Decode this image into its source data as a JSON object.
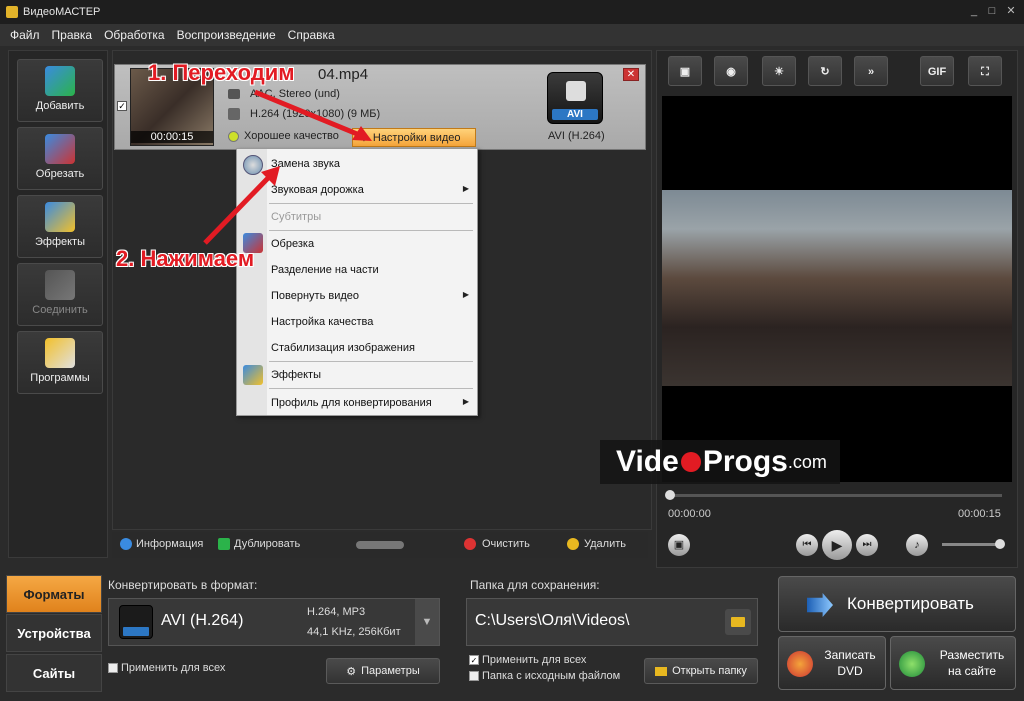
{
  "window": {
    "title": "ВидеоМАСТЕР"
  },
  "menu": [
    "Файл",
    "Правка",
    "Обработка",
    "Воспроизведение",
    "Справка"
  ],
  "tools": [
    {
      "label": "Добавить",
      "icon": "film-add-icon",
      "enabled": true
    },
    {
      "label": "Обрезать",
      "icon": "scissors-icon",
      "enabled": true
    },
    {
      "label": "Эффекты",
      "icon": "magic-wand-icon",
      "enabled": true
    },
    {
      "label": "Соединить",
      "icon": "film-join-icon",
      "enabled": false
    },
    {
      "label": "Программы",
      "icon": "programs-icon",
      "enabled": true
    }
  ],
  "file": {
    "name": "04.mp4",
    "audio": "AAC, Stereo (und)",
    "video": "H.264 (1920x1080) (9 МБ)",
    "duration": "00:00:15",
    "quality": "Хорошее качество",
    "settings_button": "Настройки видео",
    "format_label": "AVI (H.264)",
    "format_badge": "AVI"
  },
  "context_menu": [
    {
      "label": "Замена звука",
      "enabled": true
    },
    {
      "label": "Звуковая дорожка",
      "enabled": true,
      "submenu": true
    },
    {
      "label": "Субтитры",
      "enabled": false
    },
    {
      "label": "Обрезка",
      "enabled": true
    },
    {
      "label": "Разделение на части",
      "enabled": true
    },
    {
      "label": "Повернуть видео",
      "enabled": true,
      "submenu": true
    },
    {
      "label": "Настройка качества",
      "enabled": true
    },
    {
      "label": "Стабилизация изображения",
      "enabled": true
    },
    {
      "label": "Эффекты",
      "enabled": true
    },
    {
      "label": "Профиль для конвертирования",
      "enabled": true,
      "submenu": true
    }
  ],
  "annotations": {
    "step1": "1. Переходим",
    "step2": "2. Нажимаем"
  },
  "file_toolbar": {
    "info": "Информация",
    "duplicate": "Дублировать",
    "clear": "Очистить",
    "delete": "Удалить"
  },
  "preview": {
    "watermark_a": "Vide",
    "watermark_b": "Progs",
    "watermark_c": ".com",
    "time_start": "00:00:00",
    "time_end": "00:00:15",
    "progress": 0.0,
    "volume": 1.0
  },
  "preview_toolbar": [
    "crop-icon",
    "snapshot-icon",
    "brightness-icon",
    "rotate-icon",
    "speed-icon",
    "GIF",
    "fullscreen-icon"
  ],
  "tabs": [
    {
      "label": "Форматы",
      "active": true
    },
    {
      "label": "Устройства",
      "active": false
    },
    {
      "label": "Сайты",
      "active": false
    }
  ],
  "format_section": {
    "caption": "Конвертировать в формат:",
    "name": "AVI (H.264)",
    "codecs": "H.264, MP3",
    "params": "44,1 KHz, 256Кбит",
    "apply_all": "Применить для всех",
    "params_button": "Параметры"
  },
  "folder_section": {
    "caption": "Папка для сохранения:",
    "path": "C:\\Users\\Оля\\Videos\\",
    "apply_all": "Применить для всех",
    "source_folder": "Папка с исходным файлом",
    "open_button": "Открыть папку"
  },
  "actions": {
    "convert": "Конвертировать",
    "dvd_line1": "Записать",
    "dvd_line2": "DVD",
    "web_line1": "Разместить",
    "web_line2": "на сайте"
  },
  "colors": {
    "accent": "#f4a43a",
    "annotation": "#e21b23",
    "format_badge": "#2c77c4"
  }
}
